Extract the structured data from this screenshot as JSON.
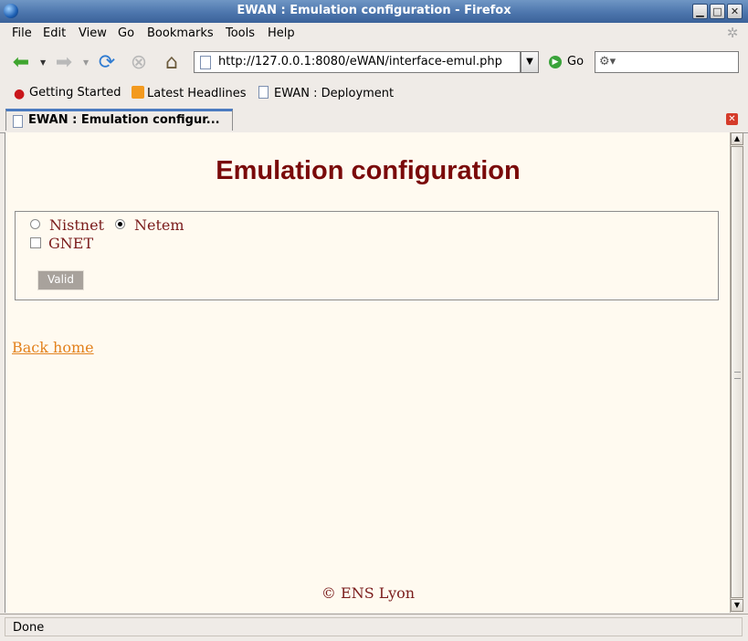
{
  "window": {
    "title": "EWAN : Emulation configuration - Firefox"
  },
  "menu": {
    "items": [
      "File",
      "Edit",
      "View",
      "Go",
      "Bookmarks",
      "Tools",
      "Help"
    ]
  },
  "toolbar": {
    "url": "http://127.0.0.1:8080/eWAN/interface-emul.php",
    "go_label": "Go",
    "search_placeholder": ""
  },
  "bookmarks": {
    "items": [
      "Getting Started",
      "Latest Headlines",
      "EWAN : Deployment"
    ]
  },
  "tab": {
    "label": "EWAN : Emulation configur..."
  },
  "page": {
    "heading": "Emulation configuration",
    "options": {
      "nistnet_label": "Nistnet",
      "netem_label": "Netem",
      "selected": "Netem",
      "gnet_label": "GNET",
      "gnet_checked": false
    },
    "valid_label": "Valid",
    "back_link": "Back home",
    "footer": "© ENS Lyon"
  },
  "status": {
    "text": "Done"
  },
  "colors": {
    "heading": "#7a0a0a",
    "link": "#e3821e",
    "page_bg": "#fffaf0",
    "text": "#7a1c1c"
  }
}
